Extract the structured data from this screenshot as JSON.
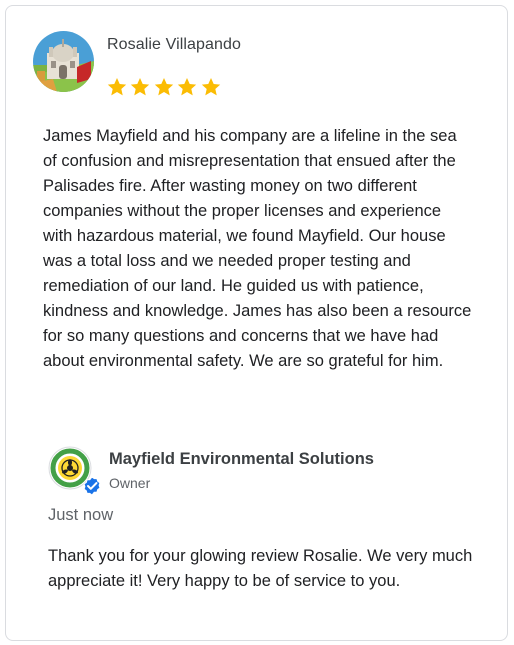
{
  "review": {
    "reviewer_name": "Rosalie Villapando",
    "rating": 5,
    "star_color": "#fbbc04",
    "text": "James Mayfield and his company are a lifeline in the sea of confusion and misrepresentation that ensued after the Palisades fire. After wasting money on two different companies without the proper licenses and experience with hazardous material, we found Mayfield. Our house was a total loss and we needed proper testing and remediation of our land. He guided us with patience, kindness and knowledge. James has also been a resource for so many questions and concerns that we have had about environmental safety. We are so grateful for him.",
    "avatar_icon": "landmark-illustration-avatar"
  },
  "owner_reply": {
    "business_name": "Mayfield Environmental Solutions",
    "role": "Owner",
    "logo_icon": "biohazard-logo-icon",
    "verified_icon": "verified-check-icon",
    "verified_color": "#1a73e8",
    "time": "Just now",
    "text": "Thank you for your glowing review Rosalie. We very much appreciate it! Very happy to be of service to you."
  }
}
